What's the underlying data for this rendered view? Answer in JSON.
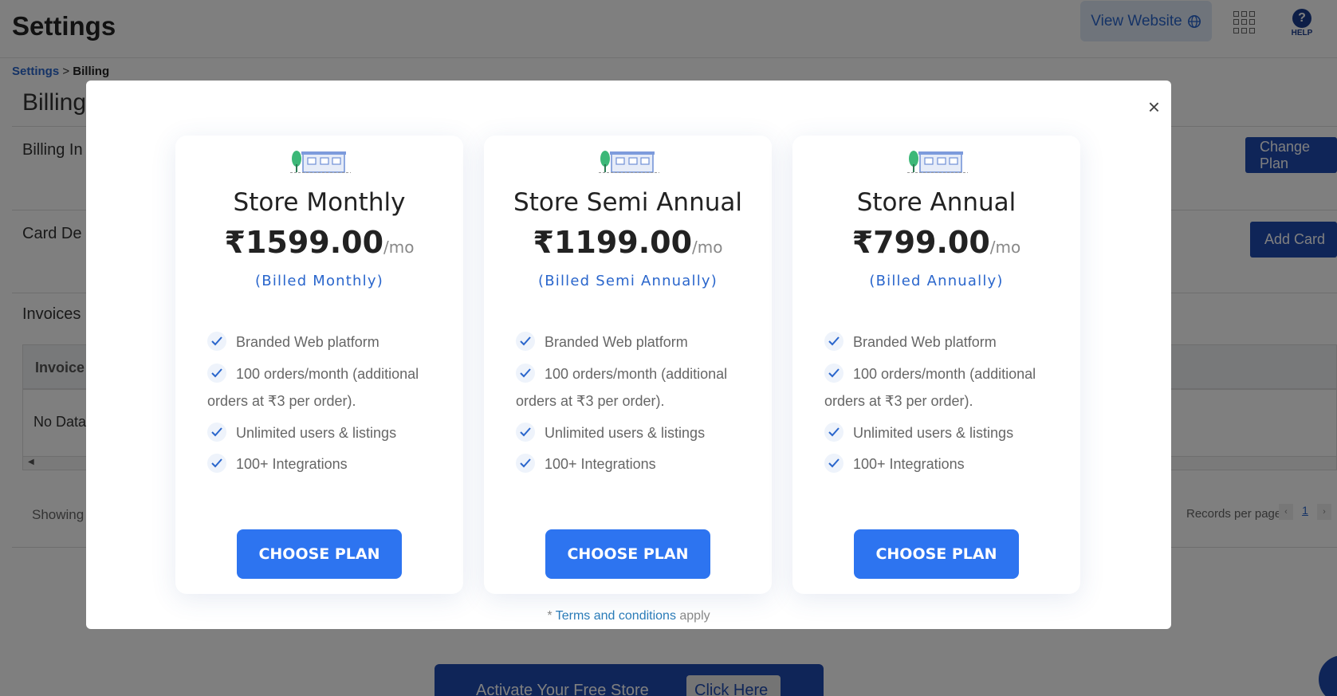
{
  "header": {
    "title": "Settings",
    "view_website": "View Website",
    "help_label": "HELP"
  },
  "breadcrumb": {
    "parent": "Settings",
    "separator": ">",
    "current": "Billing"
  },
  "background": {
    "section_title": "Billing",
    "billing_info_label": "Billing In",
    "card_details_label": "Card De",
    "invoices_label": "Invoices",
    "change_plan": "Change Plan",
    "add_card": "Add Card",
    "table_header": "Invoice",
    "no_data": "No Data",
    "showing": "Showing",
    "records_per_page": "Records per page",
    "page_number": "1",
    "activate_text": "Activate Your Free Store",
    "click_here": "Click Here"
  },
  "modal": {
    "close_glyph": "×",
    "plans": [
      {
        "name": "Store Monthly",
        "price": "₹1599.00",
        "per": "/mo",
        "billed": "(Billed Monthly)",
        "features": [
          "Branded Web platform",
          "100 orders/month (additional orders at ₹3 per order).",
          "Unlimited users & listings",
          "100+ Integrations"
        ],
        "button": "CHOOSE PLAN"
      },
      {
        "name": "Store Semi Annual",
        "price": "₹1199.00",
        "per": "/mo",
        "billed": "(Billed Semi Annually)",
        "features": [
          "Branded Web platform",
          "100 orders/month (additional orders at ₹3 per order).",
          "Unlimited users & listings",
          "100+ Integrations"
        ],
        "button": "CHOOSE PLAN"
      },
      {
        "name": "Store Annual",
        "price": "₹799.00",
        "per": "/mo",
        "billed": "(Billed Annually)",
        "features": [
          "Branded Web platform",
          "100 orders/month (additional orders at ₹3 per order).",
          "Unlimited users & listings",
          "100+ Integrations"
        ],
        "button": "CHOOSE PLAN"
      }
    ],
    "terms_prefix": "* ",
    "terms_link": "Terms and conditions",
    "terms_suffix": " apply"
  },
  "colors": {
    "accent": "#2d74f0",
    "brand_dark": "#1f4bb0",
    "link": "#2a66cc"
  },
  "icons": [
    "globe-icon",
    "apps-grid-icon",
    "help-icon",
    "close-icon",
    "store-icon",
    "check-icon"
  ]
}
